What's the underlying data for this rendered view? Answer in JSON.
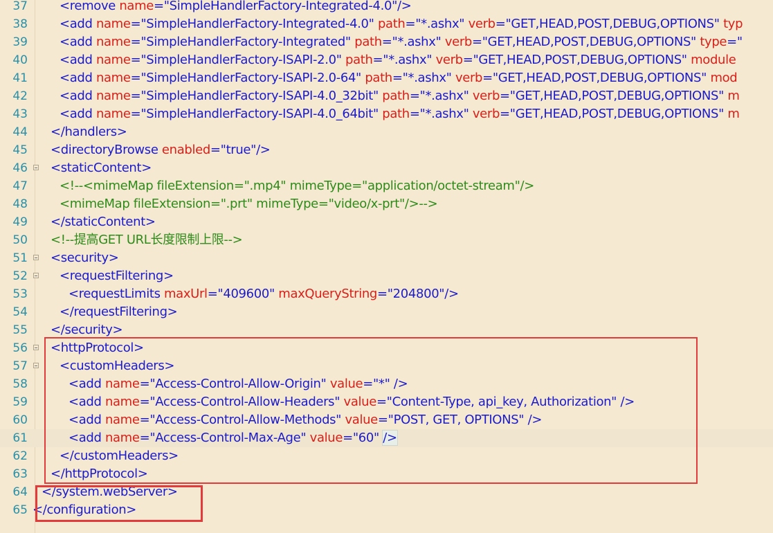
{
  "editor": {
    "colors": {
      "background": "#f5e9d1",
      "line_number": "#2a90a8",
      "tag": "#1b1bcc",
      "attribute": "#d8201a",
      "value": "#1b1bcc",
      "comment": "#2e8b1a",
      "current_line": "#f0e5ce",
      "annotation_box": "#e33b3b"
    },
    "lines": [
      {
        "n": "37",
        "indent": 4,
        "fold": false,
        "tokens": [
          {
            "t": "tag",
            "v": "<remove "
          },
          {
            "t": "attr",
            "v": "name"
          },
          {
            "t": "tag",
            "v": "="
          },
          {
            "t": "val",
            "v": "\"SimpleHandlerFactory-Integrated-4.0\""
          },
          {
            "t": "tag",
            "v": "/>"
          }
        ]
      },
      {
        "n": "38",
        "indent": 4,
        "fold": false,
        "tokens": [
          {
            "t": "tag",
            "v": "<add "
          },
          {
            "t": "attr",
            "v": "name"
          },
          {
            "t": "tag",
            "v": "="
          },
          {
            "t": "val",
            "v": "\"SimpleHandlerFactory-Integrated-4.0\" "
          },
          {
            "t": "attr",
            "v": "path"
          },
          {
            "t": "tag",
            "v": "="
          },
          {
            "t": "val",
            "v": "\"*.ashx\" "
          },
          {
            "t": "attr",
            "v": "verb"
          },
          {
            "t": "tag",
            "v": "="
          },
          {
            "t": "val",
            "v": "\"GET,HEAD,POST,DEBUG,OPTIONS\" "
          },
          {
            "t": "attr",
            "v": "typ"
          }
        ]
      },
      {
        "n": "39",
        "indent": 4,
        "fold": false,
        "tokens": [
          {
            "t": "tag",
            "v": "<add "
          },
          {
            "t": "attr",
            "v": "name"
          },
          {
            "t": "tag",
            "v": "="
          },
          {
            "t": "val",
            "v": "\"SimpleHandlerFactory-Integrated\" "
          },
          {
            "t": "attr",
            "v": "path"
          },
          {
            "t": "tag",
            "v": "="
          },
          {
            "t": "val",
            "v": "\"*.ashx\" "
          },
          {
            "t": "attr",
            "v": "verb"
          },
          {
            "t": "tag",
            "v": "="
          },
          {
            "t": "val",
            "v": "\"GET,HEAD,POST,DEBUG,OPTIONS\" "
          },
          {
            "t": "attr",
            "v": "type"
          },
          {
            "t": "tag",
            "v": "=\""
          }
        ]
      },
      {
        "n": "40",
        "indent": 4,
        "fold": false,
        "tokens": [
          {
            "t": "tag",
            "v": "<add "
          },
          {
            "t": "attr",
            "v": "name"
          },
          {
            "t": "tag",
            "v": "="
          },
          {
            "t": "val",
            "v": "\"SimpleHandlerFactory-ISAPI-2.0\" "
          },
          {
            "t": "attr",
            "v": "path"
          },
          {
            "t": "tag",
            "v": "="
          },
          {
            "t": "val",
            "v": "\"*.ashx\" "
          },
          {
            "t": "attr",
            "v": "verb"
          },
          {
            "t": "tag",
            "v": "="
          },
          {
            "t": "val",
            "v": "\"GET,HEAD,POST,DEBUG,OPTIONS\" "
          },
          {
            "t": "attr",
            "v": "module"
          }
        ]
      },
      {
        "n": "41",
        "indent": 4,
        "fold": false,
        "tokens": [
          {
            "t": "tag",
            "v": "<add "
          },
          {
            "t": "attr",
            "v": "name"
          },
          {
            "t": "tag",
            "v": "="
          },
          {
            "t": "val",
            "v": "\"SimpleHandlerFactory-ISAPI-2.0-64\" "
          },
          {
            "t": "attr",
            "v": "path"
          },
          {
            "t": "tag",
            "v": "="
          },
          {
            "t": "val",
            "v": "\"*.ashx\" "
          },
          {
            "t": "attr",
            "v": "verb"
          },
          {
            "t": "tag",
            "v": "="
          },
          {
            "t": "val",
            "v": "\"GET,HEAD,POST,DEBUG,OPTIONS\" "
          },
          {
            "t": "attr",
            "v": "mod"
          }
        ]
      },
      {
        "n": "42",
        "indent": 4,
        "fold": false,
        "tokens": [
          {
            "t": "tag",
            "v": "<add "
          },
          {
            "t": "attr",
            "v": "name"
          },
          {
            "t": "tag",
            "v": "="
          },
          {
            "t": "val",
            "v": "\"SimpleHandlerFactory-ISAPI-4.0_32bit\" "
          },
          {
            "t": "attr",
            "v": "path"
          },
          {
            "t": "tag",
            "v": "="
          },
          {
            "t": "val",
            "v": "\"*.ashx\" "
          },
          {
            "t": "attr",
            "v": "verb"
          },
          {
            "t": "tag",
            "v": "="
          },
          {
            "t": "val",
            "v": "\"GET,HEAD,POST,DEBUG,OPTIONS\" "
          },
          {
            "t": "attr",
            "v": "m"
          }
        ]
      },
      {
        "n": "43",
        "indent": 4,
        "fold": false,
        "tokens": [
          {
            "t": "tag",
            "v": "<add "
          },
          {
            "t": "attr",
            "v": "name"
          },
          {
            "t": "tag",
            "v": "="
          },
          {
            "t": "val",
            "v": "\"SimpleHandlerFactory-ISAPI-4.0_64bit\" "
          },
          {
            "t": "attr",
            "v": "path"
          },
          {
            "t": "tag",
            "v": "="
          },
          {
            "t": "val",
            "v": "\"*.ashx\" "
          },
          {
            "t": "attr",
            "v": "verb"
          },
          {
            "t": "tag",
            "v": "="
          },
          {
            "t": "val",
            "v": "\"GET,HEAD,POST,DEBUG,OPTIONS\" "
          },
          {
            "t": "attr",
            "v": "m"
          }
        ]
      },
      {
        "n": "44",
        "indent": 3,
        "fold": false,
        "tokens": [
          {
            "t": "tag",
            "v": "</handlers>"
          }
        ]
      },
      {
        "n": "45",
        "indent": 3,
        "fold": false,
        "tokens": [
          {
            "t": "tag",
            "v": "<directoryBrowse "
          },
          {
            "t": "attr",
            "v": "enabled"
          },
          {
            "t": "tag",
            "v": "="
          },
          {
            "t": "val",
            "v": "\"true\""
          },
          {
            "t": "tag",
            "v": "/>"
          }
        ]
      },
      {
        "n": "46",
        "indent": 3,
        "fold": true,
        "tokens": [
          {
            "t": "tag",
            "v": "<staticContent>"
          }
        ]
      },
      {
        "n": "47",
        "indent": 4,
        "fold": false,
        "tokens": [
          {
            "t": "comment",
            "v": "<!--<mimeMap fileExtension=\".mp4\" mimeType=\"application/octet-stream\"/>"
          }
        ]
      },
      {
        "n": "48",
        "indent": 4,
        "fold": false,
        "tokens": [
          {
            "t": "comment",
            "v": "<mimeMap fileExtension=\".prt\" mimeType=\"video/x-prt\"/>-->"
          }
        ]
      },
      {
        "n": "49",
        "indent": 3,
        "fold": false,
        "tokens": [
          {
            "t": "tag",
            "v": "</staticContent>"
          }
        ]
      },
      {
        "n": "50",
        "indent": 3,
        "fold": false,
        "tokens": [
          {
            "t": "comment",
            "v": "<!--提高GET URL长度限制上限-->"
          }
        ]
      },
      {
        "n": "51",
        "indent": 3,
        "fold": true,
        "tokens": [
          {
            "t": "tag",
            "v": "<security>"
          }
        ]
      },
      {
        "n": "52",
        "indent": 4,
        "fold": true,
        "tokens": [
          {
            "t": "tag",
            "v": "<requestFiltering>"
          }
        ]
      },
      {
        "n": "53",
        "indent": 5,
        "fold": false,
        "tokens": [
          {
            "t": "tag",
            "v": "<requestLimits "
          },
          {
            "t": "attr",
            "v": "maxUrl"
          },
          {
            "t": "tag",
            "v": "="
          },
          {
            "t": "val",
            "v": "\"409600\" "
          },
          {
            "t": "attr",
            "v": "maxQueryString"
          },
          {
            "t": "tag",
            "v": "="
          },
          {
            "t": "val",
            "v": "\"204800\""
          },
          {
            "t": "tag",
            "v": "/>"
          }
        ]
      },
      {
        "n": "54",
        "indent": 4,
        "fold": false,
        "tokens": [
          {
            "t": "tag",
            "v": "</requestFiltering>"
          }
        ]
      },
      {
        "n": "55",
        "indent": 3,
        "fold": false,
        "tokens": [
          {
            "t": "tag",
            "v": "</security>"
          }
        ]
      },
      {
        "n": "56",
        "indent": 3,
        "fold": true,
        "tokens": [
          {
            "t": "tag",
            "v": "<httpProtocol>"
          }
        ]
      },
      {
        "n": "57",
        "indent": 4,
        "fold": true,
        "tokens": [
          {
            "t": "tag",
            "v": "<customHeaders>"
          }
        ]
      },
      {
        "n": "58",
        "indent": 5,
        "fold": false,
        "tokens": [
          {
            "t": "tag",
            "v": "<add "
          },
          {
            "t": "attr",
            "v": "name"
          },
          {
            "t": "tag",
            "v": "="
          },
          {
            "t": "val",
            "v": "\"Access-Control-Allow-Origin\" "
          },
          {
            "t": "attr",
            "v": "value"
          },
          {
            "t": "tag",
            "v": "="
          },
          {
            "t": "val",
            "v": "\"*\" "
          },
          {
            "t": "tag",
            "v": "/>"
          }
        ]
      },
      {
        "n": "59",
        "indent": 5,
        "fold": false,
        "tokens": [
          {
            "t": "tag",
            "v": "<add "
          },
          {
            "t": "attr",
            "v": "name"
          },
          {
            "t": "tag",
            "v": "="
          },
          {
            "t": "val",
            "v": "\"Access-Control-Allow-Headers\" "
          },
          {
            "t": "attr",
            "v": "value"
          },
          {
            "t": "tag",
            "v": "="
          },
          {
            "t": "val",
            "v": "\"Content-Type, api_key, Authorization\" "
          },
          {
            "t": "tag",
            "v": "/>"
          }
        ]
      },
      {
        "n": "60",
        "indent": 5,
        "fold": false,
        "tokens": [
          {
            "t": "tag",
            "v": "<add "
          },
          {
            "t": "attr",
            "v": "name"
          },
          {
            "t": "tag",
            "v": "="
          },
          {
            "t": "val",
            "v": "\"Access-Control-Allow-Methods\" "
          },
          {
            "t": "attr",
            "v": "value"
          },
          {
            "t": "tag",
            "v": "="
          },
          {
            "t": "val",
            "v": "\"POST, GET, OPTIONS\" "
          },
          {
            "t": "tag",
            "v": "/>"
          }
        ]
      },
      {
        "n": "61",
        "indent": 5,
        "fold": false,
        "current": true,
        "tokens": [
          {
            "t": "tag",
            "v": "<add "
          },
          {
            "t": "attr",
            "v": "name"
          },
          {
            "t": "tag",
            "v": "="
          },
          {
            "t": "val",
            "v": "\"Access-Control-Max-Age\" "
          },
          {
            "t": "attr",
            "v": "value"
          },
          {
            "t": "tag",
            "v": "="
          },
          {
            "t": "val",
            "v": "\"60\" "
          },
          {
            "t": "tag",
            "v": "/>"
          }
        ]
      },
      {
        "n": "62",
        "indent": 4,
        "fold": false,
        "tokens": [
          {
            "t": "tag",
            "v": "</customHeaders>"
          }
        ]
      },
      {
        "n": "63",
        "indent": 3,
        "fold": false,
        "tokens": [
          {
            "t": "tag",
            "v": "</httpProtocol>"
          }
        ]
      },
      {
        "n": "64",
        "indent": 2,
        "fold": false,
        "tokens": [
          {
            "t": "tag",
            "v": "</system.webServer>"
          }
        ]
      },
      {
        "n": "65",
        "indent": 1,
        "fold": false,
        "tokens": [
          {
            "t": "tag",
            "v": "</configuration>"
          }
        ]
      }
    ]
  }
}
